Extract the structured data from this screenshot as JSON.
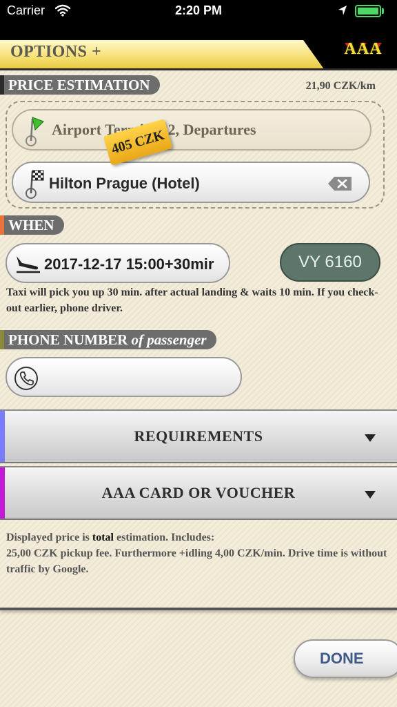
{
  "status_bar": {
    "carrier": "Carrier",
    "time": "2:20 PM"
  },
  "header": {
    "title": "OPTIONS +",
    "logo": "AAA"
  },
  "price_estimation": {
    "label": "PRICE ESTIMATION",
    "rate": "21,90 CZK/km",
    "from": "Airport Terminal 2, Departures",
    "to": "Hilton Prague (Hotel)",
    "price_tag": "405 CZK",
    "accent": "#2b2b2b"
  },
  "when": {
    "label": "WHEN",
    "datetime": "2017-12-17 15:00+30mir",
    "flight": "VY 6160",
    "info": "Taxi will pick you up 30 min. after actual landing & waits 10 min. If you check-out earlier, phone driver.",
    "accent": "#e8733a"
  },
  "phone": {
    "label_main": "PHONE NUMBER",
    "label_italic": "of passenger",
    "value": "",
    "accent": "#8a8a3a"
  },
  "requirements": {
    "label": "REQUIREMENTS",
    "accent": "#7b7bff"
  },
  "card": {
    "label": "AAA CARD OR VOUCHER",
    "accent": "#c21ad8"
  },
  "disclaimer": {
    "prefix": "Displayed price is ",
    "bold": "total",
    "suffix": " estimation. Includes:",
    "line2": "25,00 CZK pickup fee. Furthermore +idling 4,00 CZK/min. Drive time is without traffic by Google."
  },
  "done": {
    "label": "DONE"
  },
  "icons": {
    "from": "green-flag-pin-icon",
    "to": "checkered-flag-pin-icon",
    "flight": "airplane-landing-icon",
    "phone": "phone-icon",
    "clear": "clear-text-icon",
    "expand": "chevron-down-icon"
  }
}
